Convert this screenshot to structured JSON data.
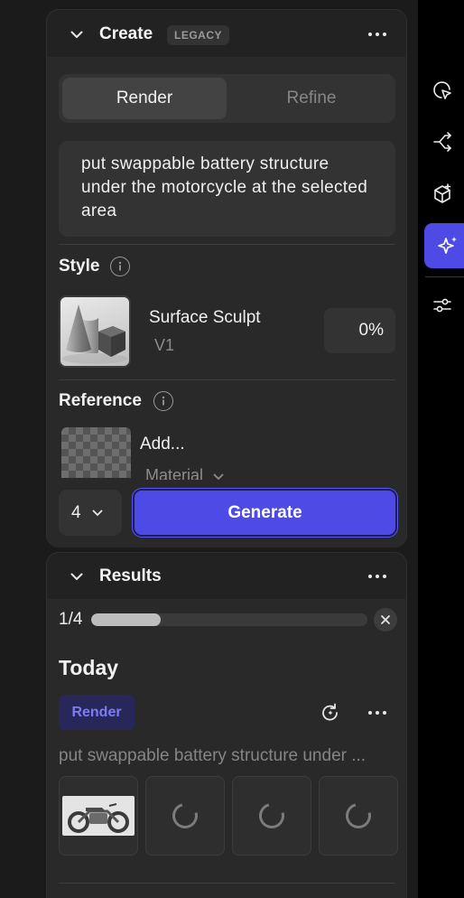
{
  "create": {
    "title": "Create",
    "badge": "LEGACY",
    "tabs": [
      {
        "label": "Render",
        "active": true
      },
      {
        "label": "Refine",
        "active": false
      }
    ],
    "prompt": "put swappable battery structure under the motorcycle at the selected area",
    "style_title": "Style",
    "style": {
      "name": "Surface Sculpt",
      "version": "V1",
      "strength": "0%"
    },
    "reference_title": "Reference",
    "reference": {
      "add_label": "Add...",
      "type_label": "Material"
    },
    "count": "4",
    "generate_label": "Generate"
  },
  "results": {
    "title": "Results",
    "progress_label": "1/4",
    "progress_fraction": 0.25,
    "day": "Today",
    "entry": {
      "mode": "Render",
      "prompt": "put swappable battery structure under ..."
    },
    "tiles": [
      {
        "state": "done",
        "icon": "motorcycle-image"
      },
      {
        "state": "loading",
        "icon": "spinner-icon"
      },
      {
        "state": "loading",
        "icon": "spinner-icon"
      },
      {
        "state": "loading",
        "icon": "spinner-icon"
      }
    ]
  },
  "rail": {
    "icons": [
      "pointer-select-icon",
      "branch-share-icon",
      "cube-add-icon",
      "sparkle-ai-icon",
      "sliders-icon"
    ],
    "active": "sparkle-ai-icon",
    "accent": "#4d4ae6"
  }
}
